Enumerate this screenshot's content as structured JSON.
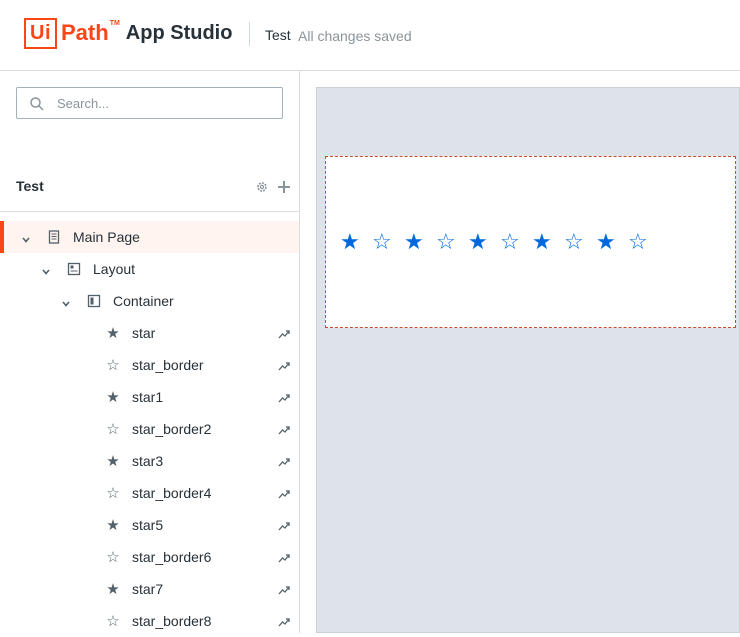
{
  "header": {
    "logo_ui": "Ui",
    "logo_path": "Path",
    "logo_tm": "TM",
    "product": "App Studio",
    "project_name": "Test",
    "save_status": "All changes saved"
  },
  "sidebar": {
    "search": {
      "placeholder": "Search...",
      "value": ""
    },
    "section_title": "Test",
    "tree": [
      {
        "label": "Main Page",
        "icon": "page-icon",
        "level": 0,
        "expanded": true,
        "selected": true
      },
      {
        "label": "Layout",
        "icon": "layout-icon",
        "level": 1,
        "expanded": true
      },
      {
        "label": "Container",
        "icon": "container-icon",
        "level": 2,
        "expanded": true
      },
      {
        "label": "star",
        "icon": "star-filled-icon",
        "level": 3
      },
      {
        "label": "star_border",
        "icon": "star-outline-icon",
        "level": 3
      },
      {
        "label": "star1",
        "icon": "star-filled-icon",
        "level": 3
      },
      {
        "label": "star_border2",
        "icon": "star-outline-icon",
        "level": 3
      },
      {
        "label": "star3",
        "icon": "star-filled-icon",
        "level": 3
      },
      {
        "label": "star_border4",
        "icon": "star-outline-icon",
        "level": 3
      },
      {
        "label": "star5",
        "icon": "star-filled-icon",
        "level": 3
      },
      {
        "label": "star_border6",
        "icon": "star-outline-icon",
        "level": 3
      },
      {
        "label": "star7",
        "icon": "star-filled-icon",
        "level": 3
      },
      {
        "label": "star_border8",
        "icon": "star-outline-icon",
        "level": 3
      }
    ]
  },
  "canvas": {
    "stars": [
      "filled",
      "outline",
      "filled",
      "outline",
      "filled",
      "outline",
      "filled",
      "outline",
      "filled",
      "outline"
    ]
  },
  "colors": {
    "brand": "#fa4616",
    "star_blue": "#0067df",
    "canvas_bg": "#dde3e8",
    "selection_border": "#c94b2b"
  }
}
